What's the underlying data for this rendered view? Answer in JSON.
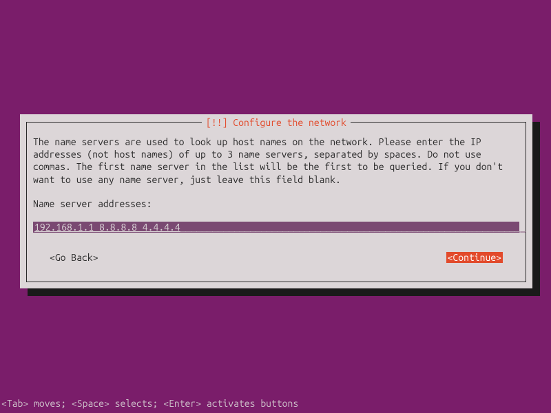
{
  "dialog": {
    "title": "[!!] Configure the network",
    "description": "The name servers are used to look up host names on the network. Please enter the IP addresses (not host names) of up to 3 name servers, separated by spaces. Do not use commas. The first name server in the list will be the first to be queried. If you don't want to use any name server, just leave this field blank.",
    "field_label": "Name server addresses:",
    "input_value": "192.168.1.1 8.8.8.8 4.4.4.4",
    "go_back_label": "<Go Back>",
    "continue_label": "<Continue>"
  },
  "footer": {
    "hint": "<Tab> moves; <Space> selects; <Enter> activates buttons"
  }
}
